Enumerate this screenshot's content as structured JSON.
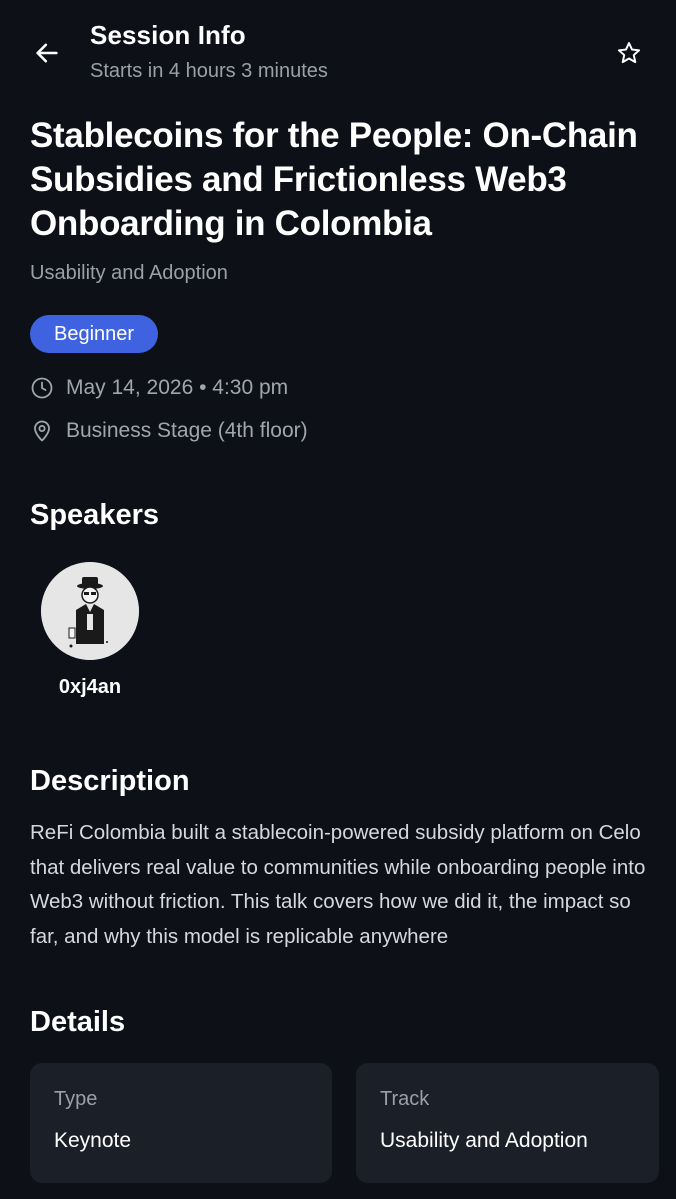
{
  "header": {
    "title": "Session Info",
    "subtitle": "Starts in 4 hours 3 minutes",
    "back_icon": "arrow-left-icon",
    "favorite_icon": "star-outline-icon"
  },
  "session": {
    "title": "Stablecoins for the People: On-Chain Subsidies and Frictionless Web3 Onboarding in Colombia",
    "track": "Usability and Adoption",
    "level": "Beginner",
    "datetime": "May 14, 2026 • 4:30 pm",
    "location": "Business Stage (4th floor)"
  },
  "speakers": {
    "heading": "Speakers",
    "items": [
      {
        "name": "0xj4an"
      }
    ]
  },
  "description": {
    "heading": "Description",
    "text": "ReFi Colombia built a stablecoin-powered subsidy platform on Celo that delivers real value to communities while onboarding people into Web3 without friction. This talk covers how we did it, the impact so far, and why this model is replicable anywhere"
  },
  "details": {
    "heading": "Details",
    "type_label": "Type",
    "type_value": "Keynote",
    "track_label": "Track",
    "track_value": "Usability and Adoption"
  },
  "colors": {
    "background": "#0d1117",
    "card": "#1b1f27",
    "badge": "#3f63e0",
    "muted_text": "#9aa0a8"
  }
}
